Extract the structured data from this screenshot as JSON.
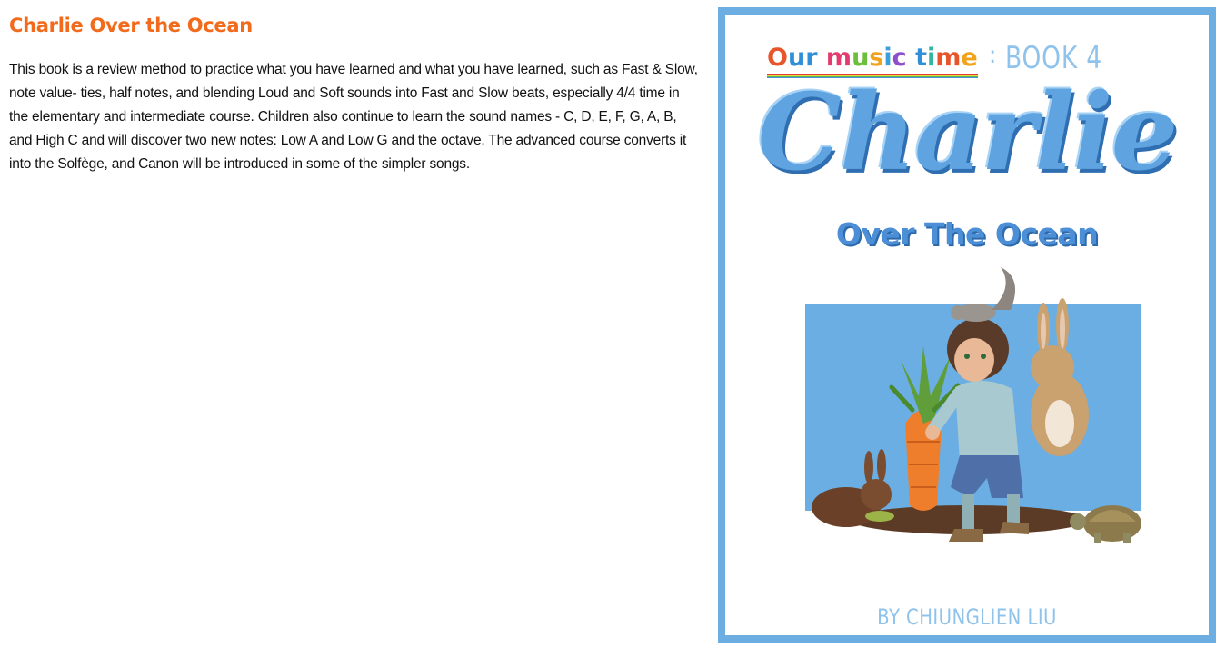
{
  "product": {
    "title": "Charlie Over the Ocean",
    "description": "This book is a review method to practice what you have learned and what you have learned, such as Fast & Slow, note value- ties, half notes, and blending Loud and Soft sounds into Fast and Slow beats, especially 4/4 time in the elementary and intermediate course. Children also continue to learn the sound names - C, D, E, F, G, A, B, and High C and will discover two new notes: Low A and Low G and the octave. The advanced course converts it into the Solfège, and Canon will be introduced in some of the simpler songs."
  },
  "cover": {
    "series_name": "Our music time",
    "separator": ":",
    "book_label": "BOOK 4",
    "title": "Charlie",
    "subtitle": "Over The Ocean",
    "author": "BY CHIUNGLIEN LIU",
    "illustration": "boy-with-rabbits-squirrel-tortoise-carrot-illustration"
  },
  "colors": {
    "title_orange": "#f26a1b",
    "cover_border_blue": "#6cade2",
    "cover_title_blue": "#5fa4e0"
  }
}
